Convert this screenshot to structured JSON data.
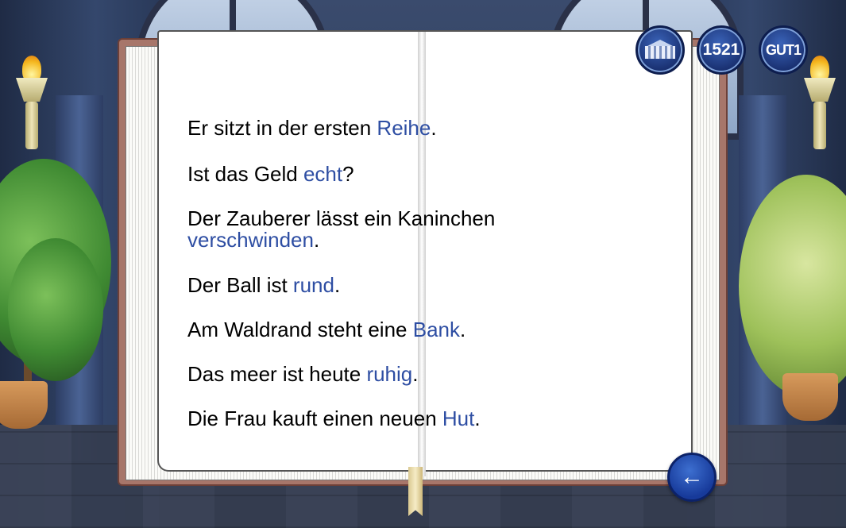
{
  "header": {
    "building_icon": "building-icon",
    "score": "1521",
    "level_label_prefix": "GUT",
    "level_label_num": "1"
  },
  "book": {
    "sentences": [
      {
        "prefix": "Er sitzt in der ersten ",
        "word": "Reihe",
        "suffix": "."
      },
      {
        "prefix": "Ist das Geld ",
        "word": "echt",
        "suffix": "?"
      },
      {
        "prefix": "Der Zauberer lässt ein Kaninchen ",
        "word": "verschwinden",
        "suffix": "."
      },
      {
        "prefix": "Der Ball ist ",
        "word": "rund",
        "suffix": "."
      },
      {
        "prefix": "Am Waldrand steht eine ",
        "word": "Bank",
        "suffix": "."
      },
      {
        "prefix": "Das meer ist heute ",
        "word": "ruhig",
        "suffix": "."
      },
      {
        "prefix": "Die Frau kauft einen neuen ",
        "word": "Hut",
        "suffix": "."
      }
    ]
  },
  "navigation": {
    "back_icon": "arrow-left-icon",
    "back_glyph": "←"
  },
  "colors": {
    "highlight_word": "#2e4ea3",
    "badge_blue": "#1a3172"
  }
}
